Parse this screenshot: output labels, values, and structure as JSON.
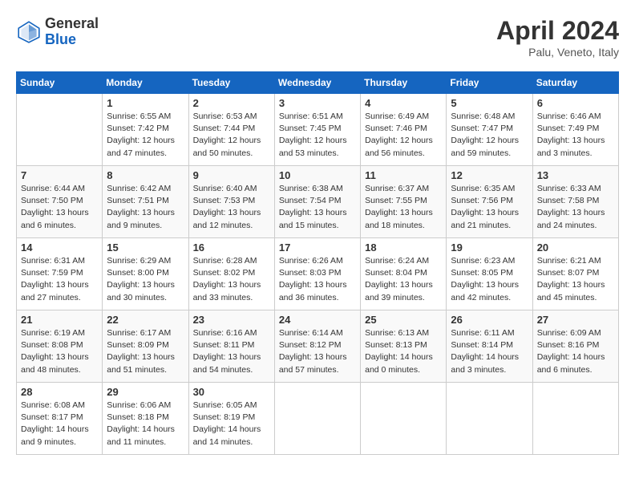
{
  "logo": {
    "general": "General",
    "blue": "Blue"
  },
  "title": {
    "month_year": "April 2024",
    "location": "Palu, Veneto, Italy"
  },
  "days_of_week": [
    "Sunday",
    "Monday",
    "Tuesday",
    "Wednesday",
    "Thursday",
    "Friday",
    "Saturday"
  ],
  "weeks": [
    [
      {
        "day": "",
        "info": ""
      },
      {
        "day": "1",
        "info": "Sunrise: 6:55 AM\nSunset: 7:42 PM\nDaylight: 12 hours\nand 47 minutes."
      },
      {
        "day": "2",
        "info": "Sunrise: 6:53 AM\nSunset: 7:44 PM\nDaylight: 12 hours\nand 50 minutes."
      },
      {
        "day": "3",
        "info": "Sunrise: 6:51 AM\nSunset: 7:45 PM\nDaylight: 12 hours\nand 53 minutes."
      },
      {
        "day": "4",
        "info": "Sunrise: 6:49 AM\nSunset: 7:46 PM\nDaylight: 12 hours\nand 56 minutes."
      },
      {
        "day": "5",
        "info": "Sunrise: 6:48 AM\nSunset: 7:47 PM\nDaylight: 12 hours\nand 59 minutes."
      },
      {
        "day": "6",
        "info": "Sunrise: 6:46 AM\nSunset: 7:49 PM\nDaylight: 13 hours\nand 3 minutes."
      }
    ],
    [
      {
        "day": "7",
        "info": "Sunrise: 6:44 AM\nSunset: 7:50 PM\nDaylight: 13 hours\nand 6 minutes."
      },
      {
        "day": "8",
        "info": "Sunrise: 6:42 AM\nSunset: 7:51 PM\nDaylight: 13 hours\nand 9 minutes."
      },
      {
        "day": "9",
        "info": "Sunrise: 6:40 AM\nSunset: 7:53 PM\nDaylight: 13 hours\nand 12 minutes."
      },
      {
        "day": "10",
        "info": "Sunrise: 6:38 AM\nSunset: 7:54 PM\nDaylight: 13 hours\nand 15 minutes."
      },
      {
        "day": "11",
        "info": "Sunrise: 6:37 AM\nSunset: 7:55 PM\nDaylight: 13 hours\nand 18 minutes."
      },
      {
        "day": "12",
        "info": "Sunrise: 6:35 AM\nSunset: 7:56 PM\nDaylight: 13 hours\nand 21 minutes."
      },
      {
        "day": "13",
        "info": "Sunrise: 6:33 AM\nSunset: 7:58 PM\nDaylight: 13 hours\nand 24 minutes."
      }
    ],
    [
      {
        "day": "14",
        "info": "Sunrise: 6:31 AM\nSunset: 7:59 PM\nDaylight: 13 hours\nand 27 minutes."
      },
      {
        "day": "15",
        "info": "Sunrise: 6:29 AM\nSunset: 8:00 PM\nDaylight: 13 hours\nand 30 minutes."
      },
      {
        "day": "16",
        "info": "Sunrise: 6:28 AM\nSunset: 8:02 PM\nDaylight: 13 hours\nand 33 minutes."
      },
      {
        "day": "17",
        "info": "Sunrise: 6:26 AM\nSunset: 8:03 PM\nDaylight: 13 hours\nand 36 minutes."
      },
      {
        "day": "18",
        "info": "Sunrise: 6:24 AM\nSunset: 8:04 PM\nDaylight: 13 hours\nand 39 minutes."
      },
      {
        "day": "19",
        "info": "Sunrise: 6:23 AM\nSunset: 8:05 PM\nDaylight: 13 hours\nand 42 minutes."
      },
      {
        "day": "20",
        "info": "Sunrise: 6:21 AM\nSunset: 8:07 PM\nDaylight: 13 hours\nand 45 minutes."
      }
    ],
    [
      {
        "day": "21",
        "info": "Sunrise: 6:19 AM\nSunset: 8:08 PM\nDaylight: 13 hours\nand 48 minutes."
      },
      {
        "day": "22",
        "info": "Sunrise: 6:17 AM\nSunset: 8:09 PM\nDaylight: 13 hours\nand 51 minutes."
      },
      {
        "day": "23",
        "info": "Sunrise: 6:16 AM\nSunset: 8:11 PM\nDaylight: 13 hours\nand 54 minutes."
      },
      {
        "day": "24",
        "info": "Sunrise: 6:14 AM\nSunset: 8:12 PM\nDaylight: 13 hours\nand 57 minutes."
      },
      {
        "day": "25",
        "info": "Sunrise: 6:13 AM\nSunset: 8:13 PM\nDaylight: 14 hours\nand 0 minutes."
      },
      {
        "day": "26",
        "info": "Sunrise: 6:11 AM\nSunset: 8:14 PM\nDaylight: 14 hours\nand 3 minutes."
      },
      {
        "day": "27",
        "info": "Sunrise: 6:09 AM\nSunset: 8:16 PM\nDaylight: 14 hours\nand 6 minutes."
      }
    ],
    [
      {
        "day": "28",
        "info": "Sunrise: 6:08 AM\nSunset: 8:17 PM\nDaylight: 14 hours\nand 9 minutes."
      },
      {
        "day": "29",
        "info": "Sunrise: 6:06 AM\nSunset: 8:18 PM\nDaylight: 14 hours\nand 11 minutes."
      },
      {
        "day": "30",
        "info": "Sunrise: 6:05 AM\nSunset: 8:19 PM\nDaylight: 14 hours\nand 14 minutes."
      },
      {
        "day": "",
        "info": ""
      },
      {
        "day": "",
        "info": ""
      },
      {
        "day": "",
        "info": ""
      },
      {
        "day": "",
        "info": ""
      }
    ]
  ]
}
